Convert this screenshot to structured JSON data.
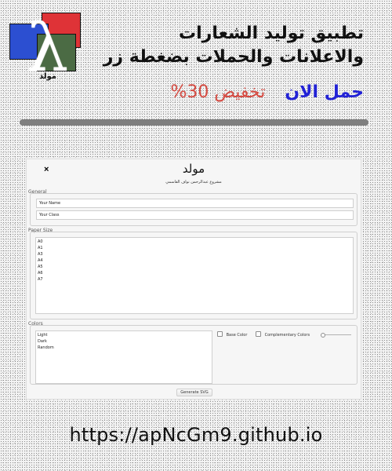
{
  "logo": {
    "glyph": "λ",
    "caption": "مولد",
    "colors": [
      "#df3337",
      "#2c4fd1",
      "#4b6b44"
    ]
  },
  "promo": {
    "headline": "تطبيق توليد الشعارات والاعلانات والحملات بضغطة زر",
    "cta": "حمل الان",
    "discount": "تخفيض 30%",
    "accent_colors": {
      "cta": "#2222d6",
      "discount": "#d64b42"
    }
  },
  "app": {
    "close_label": "×",
    "title": "مولد",
    "subtitle": "مشروع عبدالرحمن نواف القاسمي",
    "general": {
      "label": "General",
      "name_value": "Your Name",
      "class_value": "Your Class"
    },
    "paper_size": {
      "label": "Paper Size",
      "options": [
        "A0",
        "A1",
        "A3",
        "A4",
        "A5",
        "A6",
        "A7"
      ]
    },
    "colors": {
      "label": "Colors",
      "options": [
        "Light",
        "Dark",
        "Random"
      ],
      "base_color_label": "Base Color",
      "complementary_label": "Complementary Colors",
      "slider_level": 0
    },
    "generate_label": "Generate SVG"
  },
  "footer": {
    "url": "https://apNcGm9.github.io"
  }
}
